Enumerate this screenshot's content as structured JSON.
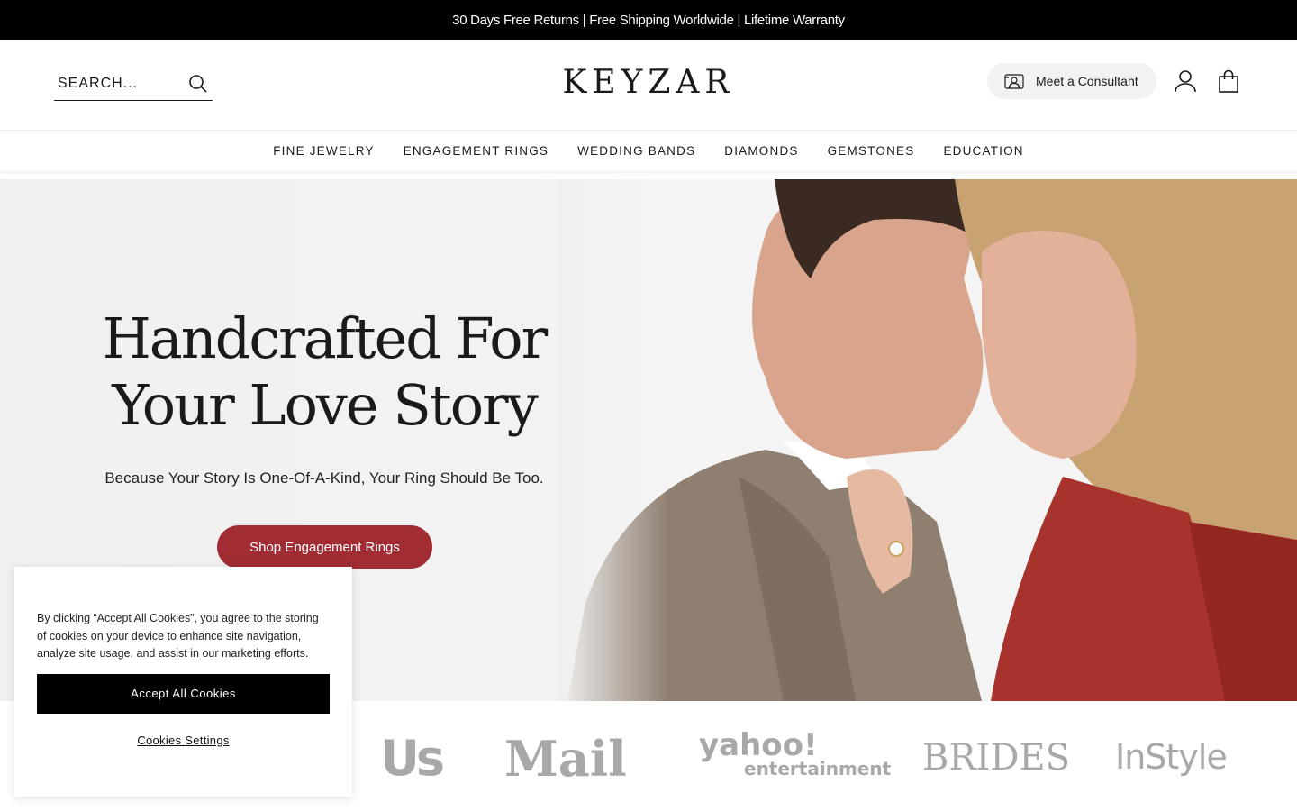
{
  "announcement": {
    "text": "30 Days Free Returns | Free Shipping Worldwide | Lifetime Warranty"
  },
  "header": {
    "search": {
      "placeholder": "SEARCH...",
      "icon": "search-icon"
    },
    "logo": "KEYZAR",
    "consultant": {
      "label": "Meet a Consultant",
      "icon": "consultant-icon"
    },
    "account_icon": "user-icon",
    "bag_icon": "shopping-bag-icon"
  },
  "nav": {
    "items": [
      {
        "label": "FINE JEWELRY"
      },
      {
        "label": "ENGAGEMENT RINGS"
      },
      {
        "label": "WEDDING BANDS"
      },
      {
        "label": "DIAMONDS"
      },
      {
        "label": "GEMSTONES"
      },
      {
        "label": "EDUCATION"
      }
    ]
  },
  "hero": {
    "title_line1": "Handcrafted For",
    "title_line2": "Your Love Story",
    "subtitle": "Because Your Story Is One-Of-A-Kind, Your Ring Should Be Too.",
    "cta": "Shop Engagement Rings",
    "cta_color": "#a12c33"
  },
  "press": {
    "logos": [
      "Us",
      "Mail",
      "yahoo!",
      "entertainment",
      "BRIDES",
      "InStyle"
    ]
  },
  "cookie_banner": {
    "text": "By clicking “Accept All Cookies”, you agree to the storing of cookies on your device to enhance site navigation, analyze site usage, and assist in our marketing efforts.",
    "accept_label": "Accept All Cookies",
    "settings_label": "Cookies Settings"
  }
}
